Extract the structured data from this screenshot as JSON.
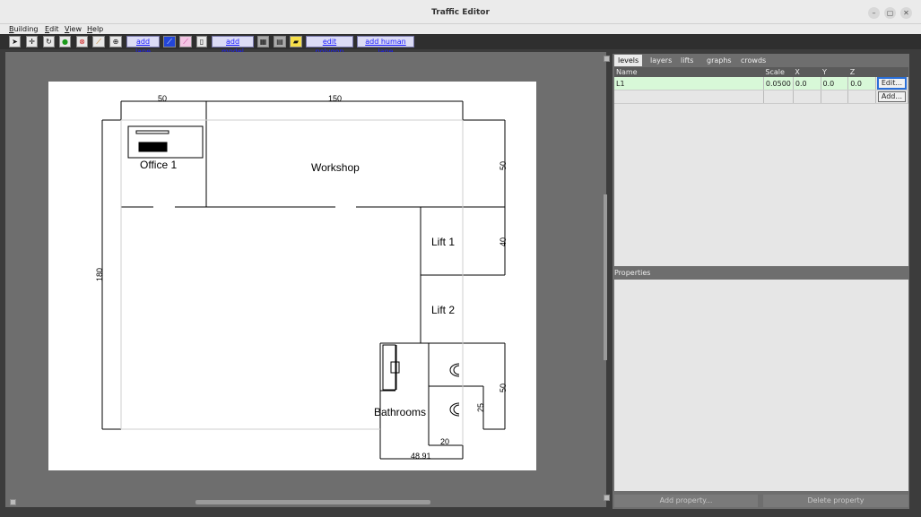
{
  "window": {
    "title": "Traffic Editor",
    "minimize": "–",
    "maximize": "▢",
    "close": "✕"
  },
  "menu": {
    "building": "Building",
    "edit": "Edit",
    "view": "View",
    "help": "Help"
  },
  "toolbar": {
    "add_lane": "add lane",
    "add_model": "add model",
    "edit_polygon": "edit polygon",
    "add_human_lane": "add human lane"
  },
  "map": {
    "rooms": [
      "Office 1",
      "Workshop",
      "Lift 1",
      "Lift 2",
      "Bathrooms"
    ],
    "dimensions": {
      "d50_top": "50",
      "d150_top": "150",
      "d50_right": "50",
      "d40": "40",
      "d180": "180",
      "d50_bath": "50",
      "d25": "25",
      "d20": "20",
      "d4891": "48.91"
    }
  },
  "levels": {
    "tabs": [
      "levels",
      "layers",
      "lifts",
      "graphs",
      "crowds"
    ],
    "columns": [
      "Name",
      "Scale",
      "X",
      "Y",
      "Z"
    ],
    "rows": [
      {
        "name": "L1",
        "scale": "0.0500",
        "x": "0.0",
        "y": "0.0",
        "z": "0.0",
        "button": "Edit..."
      }
    ],
    "add_button": "Add..."
  },
  "properties": {
    "label": "Properties",
    "add_button": "Add property...",
    "delete_button": "Delete property"
  }
}
